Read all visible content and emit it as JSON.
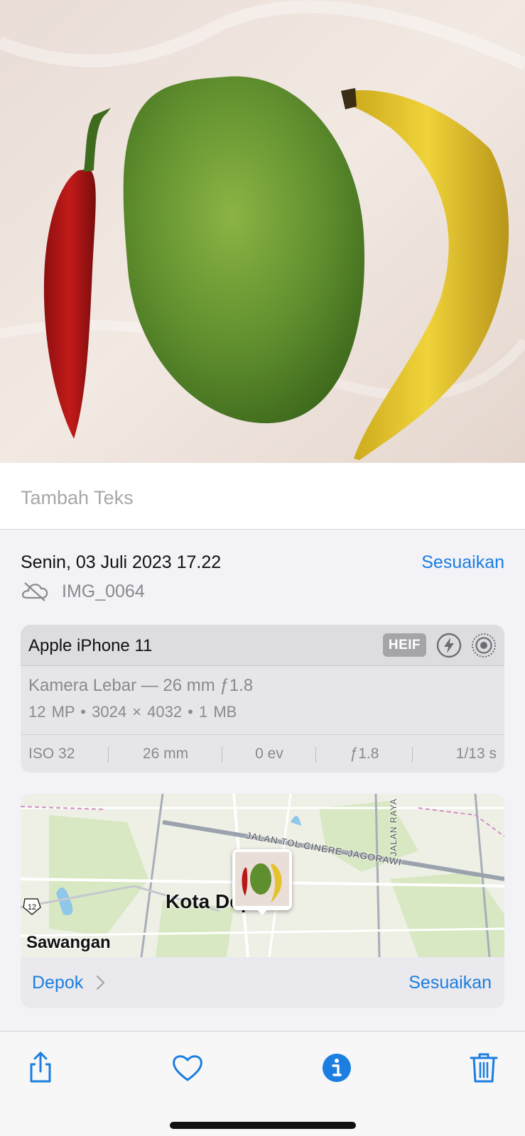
{
  "caption": {
    "placeholder": "Tambah Teks"
  },
  "info": {
    "date": "Senin, 03 Juli 2023 17.22",
    "adjust_label": "Sesuaikan",
    "file_name": "IMG_0064",
    "file_icon": "cloud-slash-icon"
  },
  "camera": {
    "model": "Apple iPhone 11",
    "format_badge": "HEIF",
    "flash_icon": "flash-icon",
    "live_icon": "live-photo-icon",
    "lens": "Kamera Lebar — 26 mm ƒ1.8",
    "specs": "12 MP  •  3024 × 4032  •  1 MB",
    "stats": [
      "ISO 32",
      "26 mm",
      "0 ev",
      "ƒ1.8",
      "1/13 s"
    ]
  },
  "map": {
    "labels": {
      "city": "Kota Depok",
      "area": "Sawangan",
      "road": "JALAN TOL CINERE–JAGORAWI",
      "road2": "JALAN RAYA",
      "route": "12"
    },
    "place": "Depok",
    "adjust_label": "Sesuaikan"
  },
  "toolbar": {
    "share": "share-icon",
    "favorite": "heart-icon",
    "info": "info-icon",
    "delete": "trash-icon"
  },
  "colors": {
    "accent": "#1b7ee0",
    "background": "#f2f2f7"
  }
}
